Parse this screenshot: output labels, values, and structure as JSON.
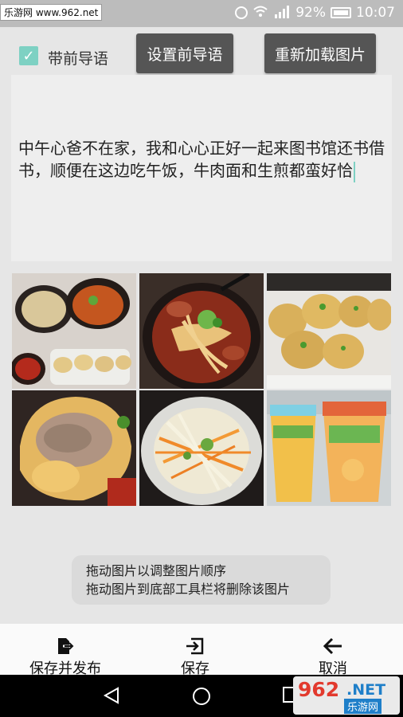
{
  "status_bar": {
    "watermark": "乐游网 www.962.net",
    "battery_pct": "92%",
    "time": "10:07",
    "icons": [
      "alarm-icon",
      "wifi-icon",
      "signal-icon",
      "battery-icon"
    ]
  },
  "header": {
    "guide_checkbox": {
      "label": "带前导语",
      "checked": true
    },
    "set_guide_button": "设置前导语",
    "reload_images_button": "重新加载图片"
  },
  "post": {
    "text": "中午心爸不在家，我和心心正好一起来图书馆还书借书，顺便在这边吃午饭，牛肉面和生煎都蛮好恰"
  },
  "photos": [
    {
      "name": "noodle-spread-photo"
    },
    {
      "name": "beef-noodle-photo"
    },
    {
      "name": "pan-fried-buns-photo"
    },
    {
      "name": "bun-closeup-photo"
    },
    {
      "name": "salad-photo"
    },
    {
      "name": "drinks-photo"
    }
  ],
  "hint": {
    "line1": "拖动图片以调整图片顺序",
    "line2": "拖动图片到底部工具栏将删除该图片"
  },
  "toolbar": {
    "save_publish": "保存并发布",
    "save": "保存",
    "cancel": "取消"
  },
  "badge": {
    "top": "962",
    "net": ".NET",
    "bottom": "乐游网"
  },
  "colors": {
    "accent": "#7ed1c3",
    "button_bg": "#555555",
    "page_bg": "#e6e6e6"
  }
}
